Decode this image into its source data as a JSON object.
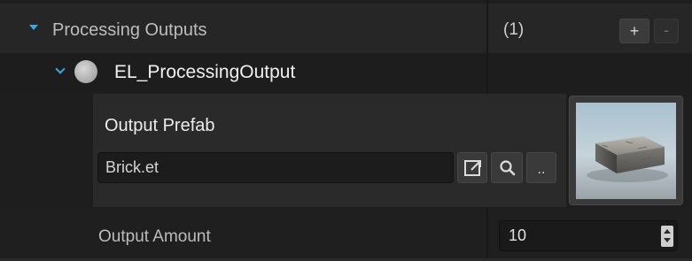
{
  "colors": {
    "accent": "#3aa7e6",
    "panel": "#2a2a2a",
    "background": "#1e1e1e"
  },
  "outputs_header": {
    "label": "Processing Outputs",
    "count": "(1)",
    "add_label": "+",
    "remove_label": "-",
    "expand_icon": "caret-down-icon"
  },
  "output_item": {
    "name": "EL_ProcessingOutput",
    "expand_icon": "chevron-down-icon",
    "status_icon": "circle-icon"
  },
  "prefab": {
    "label": "Output Prefab",
    "value": "Brick.et",
    "open_icon": "open-external-icon",
    "search_icon": "search-icon",
    "browse_label": ".."
  },
  "amount": {
    "label": "Output Amount",
    "value": "10"
  }
}
